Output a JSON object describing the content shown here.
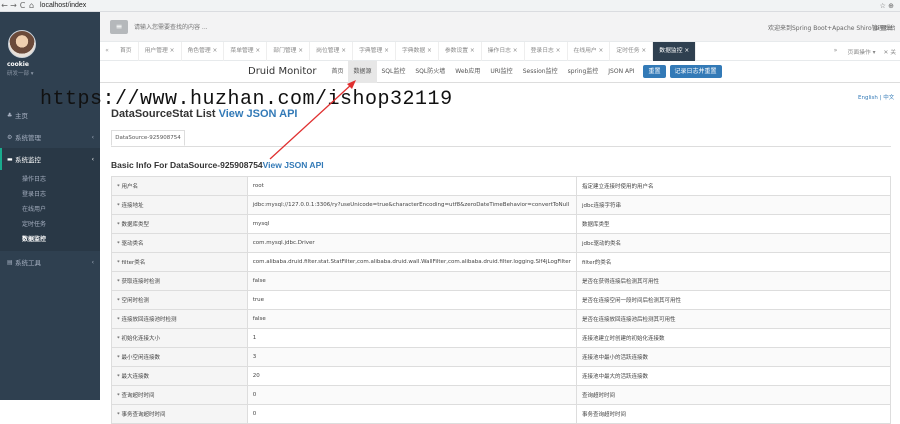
{
  "browser": {
    "back": "←",
    "forward": "→",
    "reload": "C",
    "home": "⌂",
    "url": "localhost/index",
    "right_icons": "☆ ⊕"
  },
  "sidebar": {
    "username": "cookie",
    "role": "研发一部 ▾",
    "menu": [
      {
        "icon": "home-icon",
        "glyph": "♣",
        "label": "主页",
        "arrow": ""
      },
      {
        "icon": "gear-icon",
        "glyph": "⚙",
        "label": "系统管理",
        "arrow": "‹"
      },
      {
        "icon": "monitor-icon",
        "glyph": "▬",
        "label": "系统监控",
        "arrow": "‹"
      },
      {
        "icon": "tools-icon",
        "glyph": "▤",
        "label": "系统工具",
        "arrow": "‹"
      }
    ],
    "submenu": [
      "操作日志",
      "登录日志",
      "在线用户",
      "定时任务",
      "数据监控"
    ]
  },
  "topbar": {
    "toggle_glyph": "≡",
    "search_placeholder": "请输入您需要查找的内容 ...",
    "welcome": "欢迎来到Spring Boot+Apache Shiro管理后台",
    "logout": "⊕ 退出"
  },
  "tabs": {
    "prev": "«",
    "items": [
      "首页",
      "用户管理 ×",
      "角色管理 ×",
      "菜单管理 ×",
      "部门管理 ×",
      "岗位管理 ×",
      "字典管理 ×",
      "字典数据 ×",
      "参数设置 ×",
      "操作日志 ×",
      "登录日志 ×",
      "在线用户 ×",
      "定时任务 ×",
      "数据监控 ×"
    ],
    "active_index": 13,
    "next": "»",
    "ops": "页面操作 ▾",
    "close": "✕ 关"
  },
  "druid": {
    "brand": "Druid Monitor",
    "links": [
      "首页",
      "数据源",
      "SQL监控",
      "SQL防火墙",
      "Web应用",
      "URI监控",
      "Session监控",
      "spring监控",
      "JSON API"
    ],
    "active_index": 1,
    "reset_button": "重置",
    "log_reset_button": "记录日志并重置"
  },
  "lang": "English | 中文",
  "watermark": "https://www.huzhan.com/ishop32119",
  "page": {
    "title": "DataSourceStat List",
    "title_link": "View JSON API",
    "tab_label": "DataSource-925908754",
    "basic_title": "Basic Info For DataSource-925908754",
    "basic_link": "View JSON API"
  },
  "rows": [
    {
      "key": "* 用户名",
      "value": "root",
      "desc": "指定建立连接时使用的用户名"
    },
    {
      "key": "* 连接地址",
      "value": "jdbc:mysql://127.0.0.1:3306/ry?useUnicode=true&characterEncoding=utf8&zeroDateTimeBehavior=convertToNull",
      "desc": "jdbc连接字符串"
    },
    {
      "key": "* 数据库类型",
      "value": "mysql",
      "desc": "数据库类型"
    },
    {
      "key": "* 驱动类名",
      "value": "com.mysql.jdbc.Driver",
      "desc": "jdbc驱动的类名"
    },
    {
      "key": "* filter类名",
      "value": "com.alibaba.druid.filter.stat.StatFilter,com.alibaba.druid.wall.WallFilter,com.alibaba.druid.filter.logging.Slf4jLogFilter",
      "desc": "filter的类名"
    },
    {
      "key": "* 获取连接时检测",
      "value": "false",
      "desc": "是否在获得连接后检测其可用性"
    },
    {
      "key": "* 空闲时检测",
      "value": "true",
      "desc": "是否在连接空闲一段时间后检测其可用性"
    },
    {
      "key": "* 连接放回连接池时检测",
      "value": "false",
      "desc": "是否在连接放回连接池后检测其可用性"
    },
    {
      "key": "* 初始化连接大小",
      "value": "1",
      "desc": "连接池建立时创建的初始化连接数"
    },
    {
      "key": "* 最小空闲连接数",
      "value": "3",
      "desc": "连接池中最小的活跃连接数"
    },
    {
      "key": "* 最大连接数",
      "value": "20",
      "desc": "连接池中最大的活跃连接数"
    },
    {
      "key": "* 查询超时时间",
      "value": "0",
      "desc": "查询超时时间"
    },
    {
      "key": "* 事务查询超时时间",
      "value": "0",
      "desc": "事务查询超时时间"
    }
  ],
  "colors": {
    "sidebar_bg": "#2f4050",
    "accent": "#337ab7",
    "active_tab": "#2f4050",
    "arrow": "#e03030"
  }
}
